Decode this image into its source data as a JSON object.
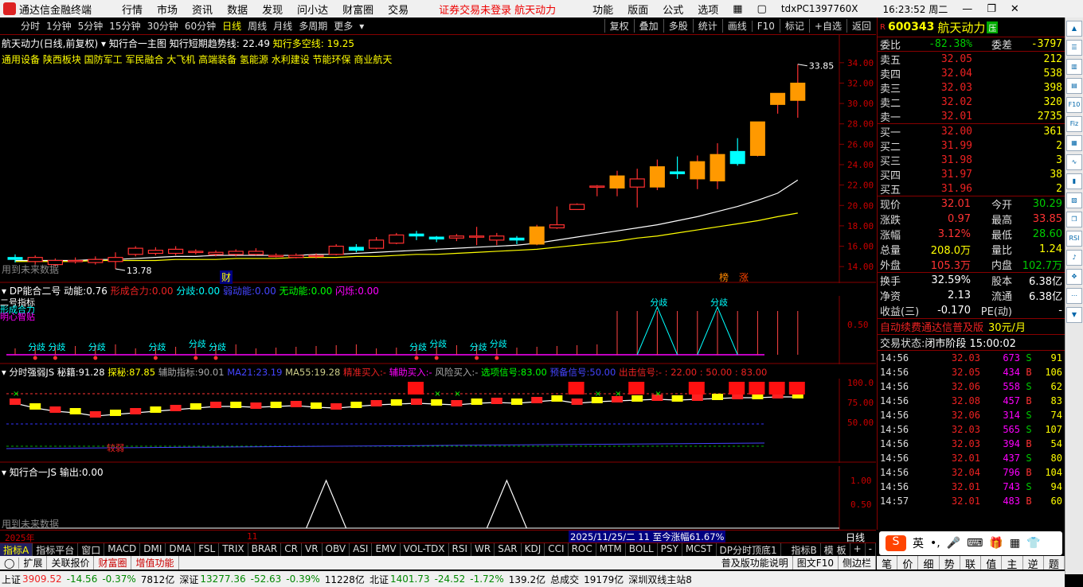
{
  "titlebar": {
    "app_name": "通达信金融终端",
    "menus": [
      "行情",
      "市场",
      "资讯",
      "数据",
      "发现",
      "问小达",
      "财富圈",
      "交易"
    ],
    "notice": "证券交易未登录",
    "stock_short": "航天动力",
    "right_menus": [
      "功能",
      "版面",
      "公式",
      "选项"
    ],
    "host": "tdxPC1397760X",
    "clock": "16:23:52 周二"
  },
  "toolbar": {
    "periods": [
      "分时",
      "1分钟",
      "5分钟",
      "15分钟",
      "30分钟",
      "60分钟",
      "日线",
      "周线",
      "月线",
      "多周期",
      "更多"
    ],
    "active_period": "日线",
    "right_buttons": [
      "复权",
      "叠加",
      "多股",
      "统计",
      "画线",
      "F10",
      "标记",
      "+自选",
      "返回"
    ]
  },
  "main_chart": {
    "header_title": "航天动力(日线,前复权)",
    "indicator_name": "知行合一主图",
    "short_trend_label": "知行短期趋势线:",
    "short_trend_value": "22.49",
    "long_trend_label": "知行多空线:",
    "long_trend_value": "19.25",
    "sectors": "通用设备 陕西板块 国防军工 军民融合 大飞机 高端装备 氢能源 水利建设 节能环保 商业航天",
    "future_note": "用到未来数据",
    "high_label": "33.85",
    "low_label": "13.78",
    "marker_cai": "财",
    "marker_bang": "榜",
    "marker_zhang": "涨",
    "y_ticks": [
      "34.00",
      "32.00",
      "30.00",
      "28.00",
      "26.00",
      "24.00",
      "22.00",
      "20.00",
      "18.00",
      "16.00",
      "14.00"
    ],
    "colors": {
      "up": "#ff3030",
      "down": "#00ffff",
      "orange": "#ff9900"
    }
  },
  "panel_dp": {
    "title": "DP能合二号",
    "dongneng_label": "动能:",
    "dongneng_value": "0.76",
    "xingcheng_label": "形成合力:",
    "xingcheng_value": "0.00",
    "fenqi_label": "分歧:",
    "fenqi_value": "0.00",
    "ruodong_label": "弱动能:",
    "ruodong_value": "0.00",
    "wudong_label": "无动能:",
    "wudong_value": "0.00",
    "shanshuo_label": "闪烁:",
    "shanshuo_value": "0.00",
    "left_legend_1": "二号指标",
    "left_legend_2": "形成合力",
    "left_legend_3": "明心智贴",
    "fenqi_tag": "分歧",
    "y_tick": "0.50"
  },
  "panel_fs": {
    "title": "分时强弱JS",
    "mj_label": "秘籍:",
    "mj_value": "91.28",
    "tm_label": "探秘:",
    "tm_value": "87.85",
    "fz_label": "辅助指标:",
    "fz_value": "90.01",
    "ma21_label": "MA21:",
    "ma21_value": "23.19",
    "ma55_label": "MA55:",
    "ma55_value": "19.28",
    "jz_label": "精准买入:",
    "jz_value": "-",
    "fb_label": "辅助买入:",
    "fb_value": "-",
    "fx_label": "风险买入:",
    "fx_value": "-",
    "xh_label": "选项信号:",
    "xh_value": "83.00",
    "yb_label": "预备信号:",
    "yb_value": "50.00",
    "cc_label": "出击信号:",
    "cc_value": "- : 22.00 : 50.00 : 83.00",
    "weak_tag": "较弱",
    "y_ticks": [
      "100.0",
      "75.00",
      "50.00"
    ]
  },
  "panel_zx": {
    "title": "知行合一JS",
    "out_label": "输出:",
    "out_value": "0.00",
    "future_note": "用到未来数据",
    "y_ticks": [
      "1.00",
      "0.50"
    ]
  },
  "time_axis": {
    "year": "2025年",
    "month": "11",
    "cursor_info": "2025/11/25/二 11 至今涨幅61.67%",
    "period_name": "日线"
  },
  "quote": {
    "code": "600343",
    "name": "航天动力",
    "badge": "R",
    "tag": "压",
    "weibi_label": "委比",
    "weibi_value": "-82.38%",
    "weicha_label": "委差",
    "weicha_value": "-3797",
    "asks": [
      {
        "label": "卖五",
        "price": "32.05",
        "vol": "212"
      },
      {
        "label": "卖四",
        "price": "32.04",
        "vol": "538"
      },
      {
        "label": "卖三",
        "price": "32.03",
        "vol": "398"
      },
      {
        "label": "卖二",
        "price": "32.02",
        "vol": "320"
      },
      {
        "label": "卖一",
        "price": "32.01",
        "vol": "2735"
      }
    ],
    "bids": [
      {
        "label": "买一",
        "price": "32.00",
        "vol": "361"
      },
      {
        "label": "买二",
        "price": "31.99",
        "vol": "2"
      },
      {
        "label": "买三",
        "price": "31.98",
        "vol": "3"
      },
      {
        "label": "买四",
        "price": "31.97",
        "vol": "38"
      },
      {
        "label": "买五",
        "price": "31.96",
        "vol": "2"
      }
    ],
    "stats": [
      [
        "现价",
        "32.01",
        "今开",
        "30.29"
      ],
      [
        "涨跌",
        "0.97",
        "最高",
        "33.85"
      ],
      [
        "涨幅",
        "3.12%",
        "最低",
        "28.60"
      ],
      [
        "总量",
        "208.0万",
        "量比",
        "1.24"
      ],
      [
        "外盘",
        "105.3万",
        "内盘",
        "102.7万"
      ]
    ],
    "stats2": [
      [
        "换手",
        "32.59%",
        "股本",
        "6.38亿"
      ],
      [
        "净资",
        "2.13",
        "流通",
        "6.38亿"
      ],
      [
        "收益(三)",
        "-0.170",
        "PE(动)",
        "-"
      ]
    ],
    "promo": "自动续费通达信普及版",
    "promo_price": "30元/月",
    "trade_status_label": "交易状态:",
    "trade_status_value": "闭市阶段 15:00:02",
    "ticks": [
      {
        "t": "14:56",
        "p": "32.03",
        "v": "673",
        "f": "S",
        "n": "91"
      },
      {
        "t": "14:56",
        "p": "32.05",
        "v": "434",
        "f": "B",
        "n": "106"
      },
      {
        "t": "14:56",
        "p": "32.06",
        "v": "558",
        "f": "S",
        "n": "62"
      },
      {
        "t": "14:56",
        "p": "32.08",
        "v": "457",
        "f": "B",
        "n": "83"
      },
      {
        "t": "14:56",
        "p": "32.06",
        "v": "314",
        "f": "S",
        "n": "74"
      },
      {
        "t": "14:56",
        "p": "32.03",
        "v": "565",
        "f": "S",
        "n": "107"
      },
      {
        "t": "14:56",
        "p": "32.03",
        "v": "394",
        "f": "B",
        "n": "54"
      },
      {
        "t": "14:56",
        "p": "32.01",
        "v": "437",
        "f": "S",
        "n": "80"
      },
      {
        "t": "14:56",
        "p": "32.04",
        "v": "796",
        "f": "B",
        "n": "104"
      },
      {
        "t": "14:56",
        "p": "32.01",
        "v": "743",
        "f": "S",
        "n": "94"
      },
      {
        "t": "14:57",
        "p": "32.01",
        "v": "483",
        "f": "B",
        "n": "60"
      }
    ]
  },
  "indicator_tabs": [
    "指标A",
    "指标平台",
    "窗口",
    "MACD",
    "DMI",
    "DMA",
    "FSL",
    "TRIX",
    "BRAR",
    "CR",
    "VR",
    "OBV",
    "ASI",
    "EMV",
    "VOL-TDX",
    "RSI",
    "WR",
    "SAR",
    "KDJ",
    "CCI",
    "ROC",
    "MTM",
    "BOLL",
    "PSY",
    "MCST",
    "DP分时顶底1",
    "指标B",
    "模 板",
    "+",
    "-"
  ],
  "bottom_tabs": [
    "扩展",
    "关联报价",
    "财富圈",
    "增值功能"
  ],
  "bottom_right": [
    "普及版功能说明",
    "图文F10",
    "侧边栏"
  ],
  "right_bottom_tabs": [
    "笔",
    "价",
    "细",
    "势",
    "联",
    "值",
    "主",
    "逆",
    "题"
  ],
  "ime": [
    "英",
    "•,"
  ],
  "statusbar": {
    "sh_label": "上证",
    "sh_val": "3909.52",
    "sh_chg": "-14.56",
    "sh_pct": "-0.37%",
    "sh_amt": "7812亿",
    "sz_label": "深证",
    "sz_val": "13277.36",
    "sz_chg": "-52.63",
    "sz_pct": "-0.39%",
    "sz_amt": "11228亿",
    "bz_label": "北证",
    "bz_val": "1401.73",
    "bz_chg": "-24.52",
    "bz_pct": "-1.72%",
    "bz_amt": "139.2亿",
    "total_label": "总成交",
    "total_val": "19179亿",
    "server": "深圳双线主站8"
  },
  "chart_data": {
    "type": "candlestick",
    "y_range": [
      13.0,
      35.0
    ],
    "candles": [
      {
        "o": 14.9,
        "c": 14.7,
        "h": 15.2,
        "l": 14.4
      },
      {
        "o": 14.5,
        "c": 14.9,
        "h": 15.1,
        "l": 14.2
      },
      {
        "o": 14.2,
        "c": 14.6,
        "h": 14.8,
        "l": 14.0
      },
      {
        "o": 14.5,
        "c": 14.6,
        "h": 14.9,
        "l": 14.3
      },
      {
        "o": 14.4,
        "c": 14.7,
        "h": 15.0,
        "l": 14.2
      },
      {
        "o": 14.5,
        "c": 14.9,
        "h": 15.4,
        "l": 13.78
      },
      {
        "o": 15.2,
        "c": 15.8,
        "h": 16.0,
        "l": 15.0
      },
      {
        "o": 15.3,
        "c": 15.6,
        "h": 15.9,
        "l": 15.1
      },
      {
        "o": 15.3,
        "c": 15.7,
        "h": 16.0,
        "l": 15.1
      },
      {
        "o": 15.4,
        "c": 15.5,
        "h": 15.7,
        "l": 15.2
      },
      {
        "o": 15.2,
        "c": 15.4,
        "h": 15.6,
        "l": 15.0
      },
      {
        "o": 15.2,
        "c": 15.5,
        "h": 15.7,
        "l": 15.0
      },
      {
        "o": 15.2,
        "c": 15.5,
        "h": 15.8,
        "l": 15.1
      },
      {
        "o": 15.0,
        "c": 15.1,
        "h": 15.3,
        "l": 14.9
      },
      {
        "o": 14.9,
        "c": 15.1,
        "h": 15.3,
        "l": 14.8
      },
      {
        "o": 15.0,
        "c": 15.1,
        "h": 15.3,
        "l": 14.8
      },
      {
        "o": 15.2,
        "c": 16.0,
        "h": 16.2,
        "l": 15.1
      },
      {
        "o": 15.9,
        "c": 15.6,
        "h": 16.2,
        "l": 15.4
      },
      {
        "o": 15.8,
        "c": 16.6,
        "h": 16.9,
        "l": 15.7
      },
      {
        "o": 16.3,
        "c": 17.1,
        "h": 17.3,
        "l": 16.2
      },
      {
        "o": 17.2,
        "c": 17.0,
        "h": 17.5,
        "l": 16.6
      },
      {
        "o": 16.9,
        "c": 16.7,
        "h": 17.0,
        "l": 16.4
      },
      {
        "o": 16.8,
        "c": 17.0,
        "h": 17.2,
        "l": 16.5
      },
      {
        "o": 16.9,
        "c": 17.0,
        "h": 17.9,
        "l": 16.1
      },
      {
        "o": 16.6,
        "c": 17.0,
        "h": 17.3,
        "l": 16.1
      },
      {
        "o": 16.8,
        "c": 16.6,
        "h": 17.0,
        "l": 16.2
      },
      {
        "o": 16.2,
        "c": 17.9,
        "h": 18.1,
        "l": 16.1
      },
      {
        "o": 17.8,
        "c": 18.1,
        "h": 19.9,
        "l": 17.7
      },
      {
        "o": 19.6,
        "c": 20.1,
        "h": 20.2,
        "l": 19.6
      },
      {
        "o": 21.9,
        "c": 21.9,
        "h": 22.0,
        "l": 20.9
      },
      {
        "o": 21.7,
        "c": 22.9,
        "h": 23.4,
        "l": 20.9
      },
      {
        "o": 21.8,
        "c": 22.6,
        "h": 23.6,
        "l": 19.8
      },
      {
        "o": 21.8,
        "c": 23.8,
        "h": 24.5,
        "l": 21.5
      },
      {
        "o": 23.3,
        "c": 23.1,
        "h": 24.8,
        "l": 22.6
      },
      {
        "o": 22.6,
        "c": 24.3,
        "h": 24.9,
        "l": 21.6
      },
      {
        "o": 22.4,
        "c": 25.0,
        "h": 26.1,
        "l": 21.6
      },
      {
        "o": 25.3,
        "c": 24.1,
        "h": 26.6,
        "l": 23.9
      },
      {
        "o": 24.9,
        "c": 28.2,
        "h": 28.2,
        "l": 24.8
      },
      {
        "o": 29.9,
        "c": 31.0,
        "h": 31.0,
        "l": 29.0
      },
      {
        "o": 30.3,
        "c": 32.0,
        "h": 33.85,
        "l": 28.6
      }
    ],
    "ma_short": [
      14.6,
      14.6,
      14.6,
      14.6,
      14.7,
      14.7,
      14.8,
      14.9,
      15.0,
      15.0,
      15.1,
      15.1,
      15.1,
      15.1,
      15.1,
      15.2,
      15.2,
      15.3,
      15.4,
      15.5,
      15.6,
      15.7,
      15.8,
      15.9,
      16.0,
      16.1,
      16.3,
      16.6,
      16.9,
      17.2,
      17.5,
      17.8,
      18.1,
      18.5,
      18.9,
      19.4,
      19.9,
      20.5,
      21.2,
      22.49
    ],
    "ma_long": [
      14.5,
      14.5,
      14.5,
      14.5,
      14.6,
      14.6,
      14.6,
      14.6,
      14.7,
      14.7,
      14.7,
      14.8,
      14.8,
      14.8,
      14.9,
      14.9,
      14.9,
      15.0,
      15.0,
      15.1,
      15.2,
      15.2,
      15.3,
      15.4,
      15.5,
      15.6,
      15.7,
      15.9,
      16.1,
      16.3,
      16.5,
      16.8,
      17.0,
      17.3,
      17.6,
      17.9,
      18.2,
      18.5,
      18.9,
      19.25
    ]
  }
}
